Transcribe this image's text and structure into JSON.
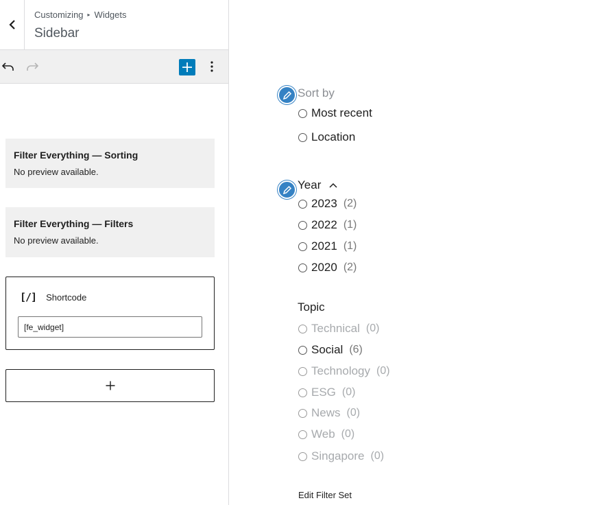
{
  "header": {
    "breadcrumb_parent": "Customizing",
    "breadcrumb_child": "Widgets",
    "title": "Sidebar"
  },
  "widgets": [
    {
      "title": "Filter Everything — Sorting",
      "description": "No preview available."
    },
    {
      "title": "Filter Everything — Filters",
      "description": "No preview available."
    }
  ],
  "shortcode_block": {
    "icon_text": "[/]",
    "label": "Shortcode",
    "value": "[fe_widget]"
  },
  "add_block_symbol": "+",
  "colors": {
    "accent": "#007cba",
    "pencil": "#3582c4"
  },
  "preview": {
    "sort": {
      "title": "Sort by",
      "options": [
        "Most recent",
        "Location"
      ]
    },
    "year": {
      "title": "Year",
      "options": [
        {
          "label": "2023",
          "count": "(2)"
        },
        {
          "label": "2022",
          "count": "(1)"
        },
        {
          "label": "2021",
          "count": "(1)"
        },
        {
          "label": "2020",
          "count": "(2)"
        }
      ]
    },
    "topic": {
      "title": "Topic",
      "options": [
        {
          "label": "Technical",
          "count": "(0)"
        },
        {
          "label": "Social",
          "count": "(6)"
        },
        {
          "label": "Technology",
          "count": "(0)"
        },
        {
          "label": "ESG",
          "count": "(0)"
        },
        {
          "label": "News",
          "count": "(0)"
        },
        {
          "label": "Web",
          "count": "(0)"
        },
        {
          "label": "Singapore",
          "count": "(0)"
        }
      ]
    },
    "edit_filter_set": "Edit Filter Set"
  }
}
